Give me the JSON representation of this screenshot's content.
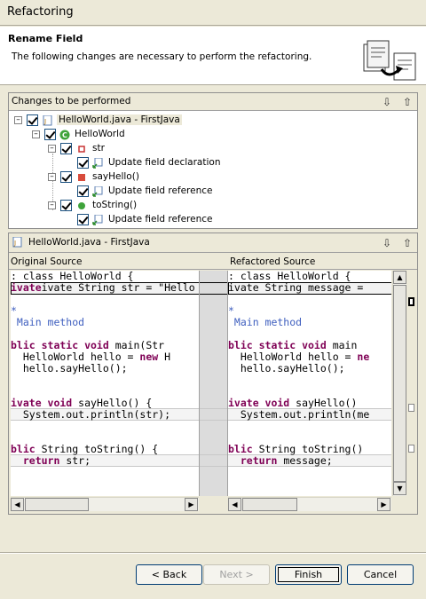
{
  "window": {
    "title": "Refactoring"
  },
  "header": {
    "title": "Rename Field",
    "description": "The following changes are necessary to perform the refactoring."
  },
  "changes": {
    "label": "Changes to be performed",
    "tree": {
      "root": "HelloWorld.java - FirstJava",
      "class": "HelloWorld",
      "str": "str",
      "str_change": "Update field declaration",
      "sayhello": "sayHello()",
      "sayhello_change": "Update field reference",
      "tostring": "toString()",
      "tostring_change": "Update field reference"
    }
  },
  "compare": {
    "file_label": "HelloWorld.java - FirstJava",
    "original_label": "Original Source",
    "refactored_label": "Refactored Source",
    "left_lines": {
      "l0": ": class HelloWorld {",
      "l1": "ivate String str = \"Hello",
      "l3": "*",
      "l4": " Main method",
      "l6a": "blic static void",
      "l6b": " main(Str",
      "l7a": "  HelloWorld hello = ",
      "l7b": "new",
      "l7c": " H",
      "l8": "  hello.sayHello();",
      "l11a": "ivate void",
      "l11b": " sayHello() {",
      "l12": "  System.out.println(str);",
      "l15a": "blic",
      "l15b": " String toString() {",
      "l16a": "  return",
      "l16b": " str;"
    },
    "right_lines": {
      "l0": ": class HelloWorld {",
      "l1": "ivate String message =",
      "l3": "*",
      "l4": " Main method",
      "l6a": "blic static void",
      "l6b": " main",
      "l7a": "  HelloWorld hello = ",
      "l7b": "ne",
      "l8": "  hello.sayHello();",
      "l11a": "ivate void",
      "l11b": " sayHello()",
      "l12": "  System.out.println(me",
      "l15a": "blic",
      "l15b": " String toString()",
      "l16a": "  return",
      "l16b": " message;"
    }
  },
  "buttons": {
    "back": "< Back",
    "next": "Next >",
    "finish": "Finish",
    "cancel": "Cancel"
  },
  "colors": {
    "keyword": "#7f0055",
    "comment": "#3f5fbf",
    "window_bg": "#ece9d8"
  }
}
